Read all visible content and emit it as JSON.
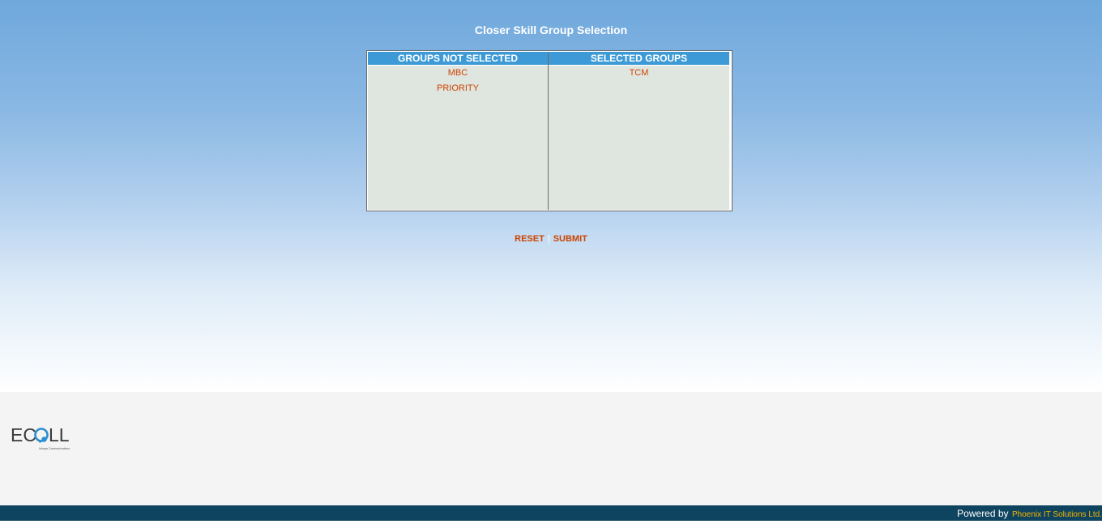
{
  "page": {
    "title": "Closer Skill Group Selection"
  },
  "groups_table": {
    "not_selected_header": "GROUPS NOT SELECTED",
    "selected_header": "SELECTED GROUPS",
    "not_selected": [
      "MBC",
      "PRIORITY"
    ],
    "selected": [
      "TCM"
    ]
  },
  "actions": {
    "reset_label": "RESET",
    "separator": "|",
    "submit_label": "SUBMIT"
  },
  "logo": {
    "text_left": "EC",
    "text_right": "LL",
    "tagline": "Infosys Communications"
  },
  "footer": {
    "powered_by": "Powered by",
    "company": "Phoenix IT Solutions Ltd."
  },
  "colors": {
    "link": "#cc4400",
    "header_bg": "#3d9ad6",
    "footer_bar": "#0f4460",
    "company": "#f7b500"
  }
}
